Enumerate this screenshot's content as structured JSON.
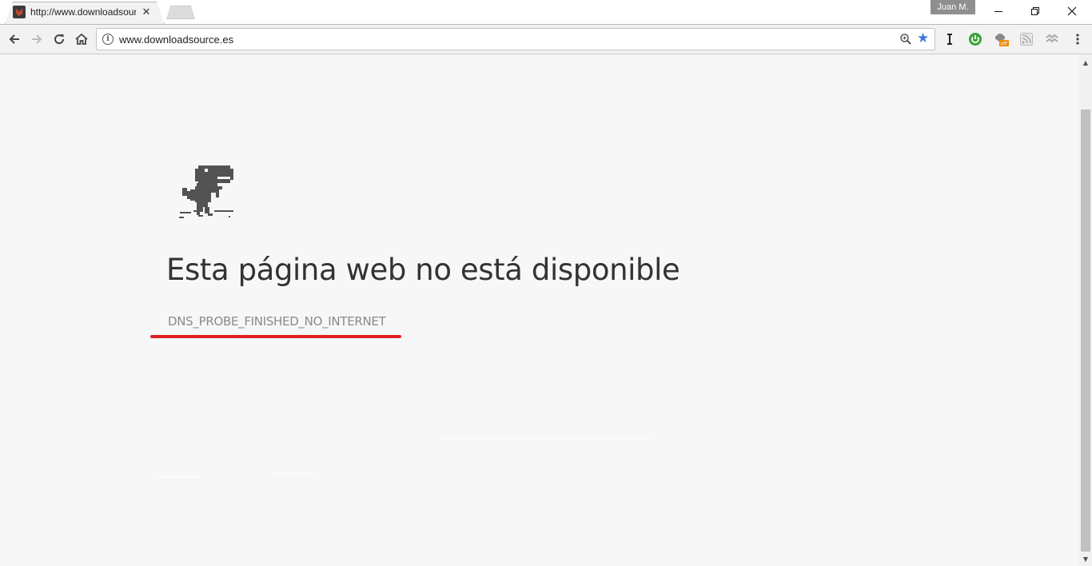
{
  "tab": {
    "title": "http://www.downloadsource.es",
    "close": "✕"
  },
  "window": {
    "user": "Juan M.",
    "minimize": "—",
    "restore": "❐",
    "close": "✕"
  },
  "toolbar": {
    "url": "www.downloadsource.es",
    "info": "i"
  },
  "extensions": {
    "badge": "off"
  },
  "page": {
    "title": "Esta página web no está disponible",
    "error_code": "DNS_PROBE_FINISHED_NO_INTERNET"
  },
  "colors": {
    "accent_star": "#3c78d8",
    "annotation_red": "#e02024",
    "title_text": "#333333",
    "error_code_text": "#8a8a8a"
  },
  "icons": [
    "back-icon",
    "forward-icon",
    "reload-icon",
    "home-icon",
    "info-icon",
    "zoom-icon",
    "bookmark-star-icon",
    "i-extension-icon",
    "green-power-icon",
    "extension-off-icon",
    "rss-icon",
    "puzzle-icon",
    "menu-icon",
    "dino-icon"
  ]
}
